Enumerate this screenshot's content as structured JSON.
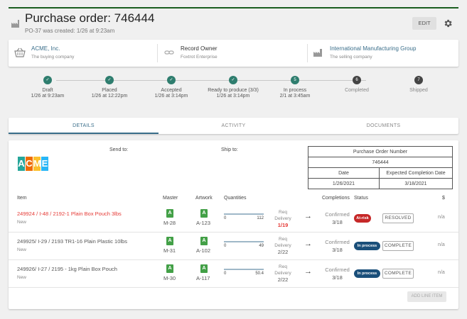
{
  "header": {
    "title": "Purchase order: 746444",
    "subtitle": "PO-37 was created: 1/26 at 9:23am",
    "edit_label": "EDIT",
    "accent": "#1b5e20"
  },
  "parties": [
    {
      "name": "ACME, Inc.",
      "sub": "The buying company",
      "icon": "basket-icon"
    },
    {
      "name": "Record Owner",
      "sub": "Foxtrot Enterprise",
      "icon": "link-icon"
    },
    {
      "name": "International Manufacturing Group",
      "sub": "The selling company",
      "icon": "factory-icon"
    }
  ],
  "steps": [
    {
      "label": "Draft",
      "date": "1/26 at 9:23am",
      "state": "done"
    },
    {
      "label": "Placed",
      "date": "1/26 at 12:22pm",
      "state": "done"
    },
    {
      "label": "Accepted",
      "date": "1/26 at 3:14pm",
      "state": "done"
    },
    {
      "label": "Ready to produce (3/3)",
      "date": "1/26 at 3:14pm",
      "state": "done"
    },
    {
      "label": "In process",
      "date": "2/1 at 3:45am",
      "num": "5",
      "state": "current"
    },
    {
      "label": "Completed",
      "date": "",
      "num": "6",
      "state": "pending"
    },
    {
      "label": "Shipped",
      "date": "",
      "num": "7",
      "state": "pending"
    }
  ],
  "tabs": [
    "DETAILS",
    "ACTIVITY",
    "DOCUMENTS"
  ],
  "details": {
    "logo_letters": [
      "A",
      "C",
      "M",
      "E"
    ],
    "send_to_label": "Send to:",
    "ship_to_label": "Ship to:",
    "po_table": {
      "number_label": "Purchase Order Number",
      "number": "746444",
      "date_label": "Date",
      "expected_label": "Expected Completion Date",
      "date": "1/26/2021",
      "expected": "3/18/2021"
    },
    "columns": {
      "item": "Item",
      "master": "Master",
      "artwork": "Artwork",
      "quantities": "Quantities",
      "completions": "Completions",
      "status": "Status",
      "dollar": "$"
    },
    "rows": [
      {
        "item": "249924 / I-48 / 2192-1 Plain Box Pouch 3lbs",
        "sub": "New",
        "master_badge": "A",
        "master_code": "M-28",
        "artwork_badge": "A",
        "artwork_code": "A-123",
        "qty_min": "0",
        "qty_max": "112",
        "req_label1": "Req",
        "req_label2": "Delivery",
        "req_date": "1/19",
        "confirmed_label": "Confirmed",
        "confirmed_date": "3/18",
        "status": "At-risk",
        "status_color": "#c62828",
        "action": "RESOLVED",
        "amount": "n/a"
      },
      {
        "item": "249925/ I-29 / 2193 TR1-16 Plain Plastic 10lbs",
        "sub": "New",
        "master_badge": "A",
        "master_code": "M-31",
        "artwork_badge": "A",
        "artwork_code": "A-102",
        "qty_min": "0",
        "qty_max": "49",
        "req_label1": "Req",
        "req_label2": "Delivery",
        "req_date": "2/22",
        "confirmed_label": "Confirmed",
        "confirmed_date": "3/18",
        "status": "In process",
        "status_color": "#1a4f7a",
        "action": "COMPLETE",
        "amount": "n/a"
      },
      {
        "item": "249926/ I-27 / 2195 - 1kg Plain Box Pouch",
        "sub": "New",
        "master_badge": "A",
        "master_code": "M-30",
        "artwork_badge": "A",
        "artwork_code": "A-117",
        "qty_min": "0",
        "qty_max": "50.4",
        "req_label1": "Req",
        "req_label2": "Delivery",
        "req_date": "2/22",
        "confirmed_label": "Confirmed",
        "confirmed_date": "3/18",
        "status": "In process",
        "status_color": "#1a4f7a",
        "action": "COMPLETE",
        "amount": "n/a"
      }
    ],
    "add_line_label": "ADD LINE ITEM"
  }
}
